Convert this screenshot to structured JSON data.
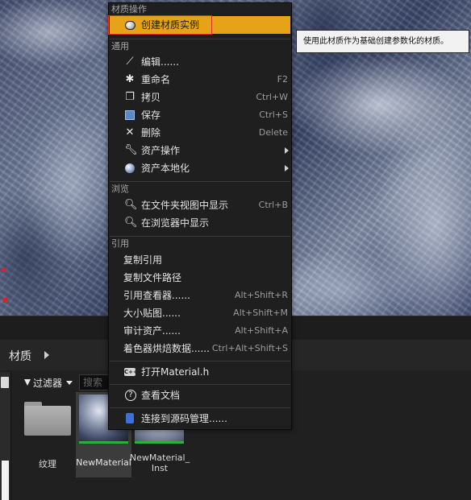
{
  "context_menu": {
    "sections": {
      "material_ops": "材质操作",
      "common": "通用",
      "browse": "浏览",
      "reference": "引用"
    },
    "items": {
      "create_instance": {
        "label": "创建材质实例",
        "icon": "material-instance-icon"
      },
      "edit": {
        "label": "编辑......",
        "icon": "edit-wand-icon"
      },
      "rename": {
        "label": "重命名",
        "shortcut": "F2",
        "icon": "rename-icon"
      },
      "duplicate": {
        "label": "拷贝",
        "shortcut": "Ctrl+W",
        "icon": "duplicate-icon"
      },
      "save": {
        "label": "保存",
        "shortcut": "Ctrl+S",
        "icon": "save-icon"
      },
      "delete": {
        "label": "删除",
        "shortcut": "Delete",
        "icon": "delete-x-icon"
      },
      "asset_actions": {
        "label": "资产操作",
        "icon": "wrench-icon"
      },
      "asset_localize": {
        "label": "资产本地化",
        "icon": "globe-icon"
      },
      "show_in_explorer": {
        "label": "在文件夹视图中显示",
        "shortcut": "Ctrl+B",
        "icon": "magnifier-icon"
      },
      "show_in_browser": {
        "label": "在浏览器中显示",
        "icon": "magnifier-icon"
      },
      "copy_reference": {
        "label": "复制引用"
      },
      "copy_file_path": {
        "label": "复制文件路径"
      },
      "reference_viewer": {
        "label": "引用查看器......",
        "shortcut": "Alt+Shift+R"
      },
      "size_map": {
        "label": "大小贴图......",
        "shortcut": "Alt+Shift+M"
      },
      "audit_assets": {
        "label": "审计资产......",
        "shortcut": "Alt+Shift+A"
      },
      "shader_cook_data": {
        "label": "着色器烘焙数据......",
        "shortcut": "Ctrl+Alt+Shift+S"
      },
      "open_header": {
        "label": "打开Material.h",
        "icon": "cpp-header-icon"
      },
      "view_docs": {
        "label": "查看文档",
        "icon": "help-icon"
      },
      "connect_source_control": {
        "label": "连接到源码管理......",
        "icon": "source-control-icon"
      }
    }
  },
  "tooltip": {
    "text": "使用此材质作为基础创建参数化的材质。"
  },
  "content_browser": {
    "title": "材质",
    "filter_label": "过滤器",
    "search_placeholder": "搜索",
    "assets": {
      "folder": {
        "label": "纹理"
      },
      "material": {
        "label": "NewMaterial"
      },
      "instance": {
        "label_line1": "NewMaterial_",
        "label_line2": "Inst"
      }
    }
  },
  "colors": {
    "highlight": "#e6a317",
    "selection_outline": "#e0302b",
    "asset_type_bar": "#2fae3a"
  }
}
